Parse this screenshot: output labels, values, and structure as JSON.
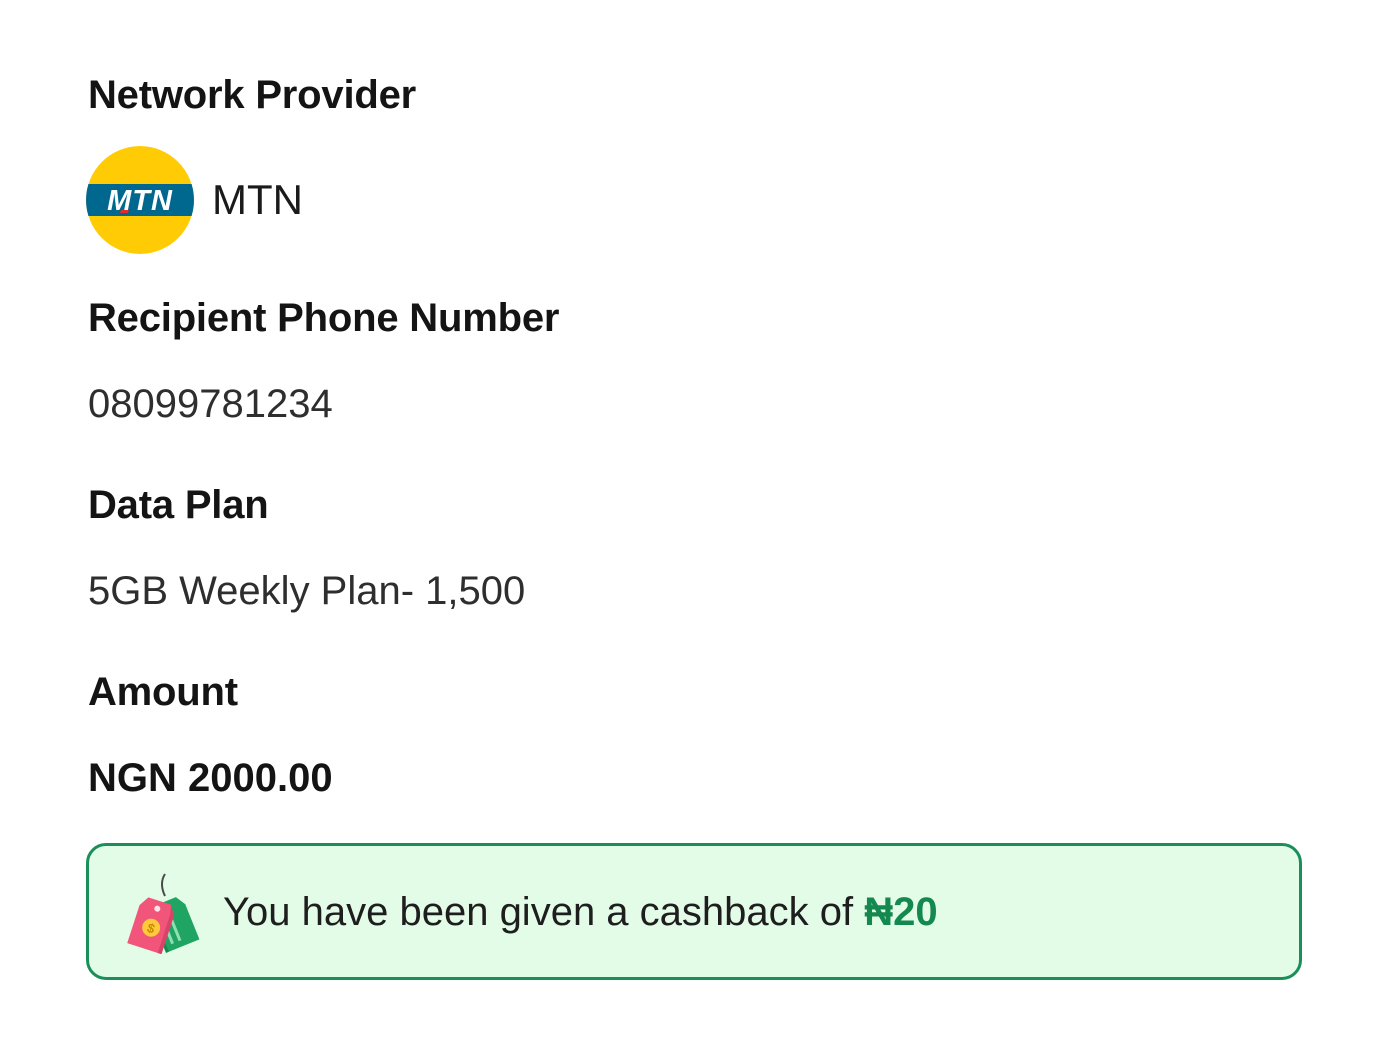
{
  "network_provider": {
    "label": "Network Provider",
    "name": "MTN",
    "logo_text": "MTN",
    "logo_icon": "mtn-logo",
    "logo_colors": {
      "yellow": "#FFCB05",
      "band": "#00678F",
      "text": "#FFFFFF",
      "accent": "#E52A2A"
    }
  },
  "recipient": {
    "label": "Recipient Phone Number",
    "phone": "08099781234"
  },
  "data_plan": {
    "label": "Data Plan",
    "value": "5GB Weekly Plan- 1,500"
  },
  "amount": {
    "label": "Amount",
    "value": "NGN 2000.00"
  },
  "cashback": {
    "message": "You have been given a cashback of",
    "amount": "₦20",
    "icon": "price-tags-icon",
    "colors": {
      "background": "#E3FCE8",
      "border": "#1A8F5A",
      "amount": "#14894F"
    }
  }
}
